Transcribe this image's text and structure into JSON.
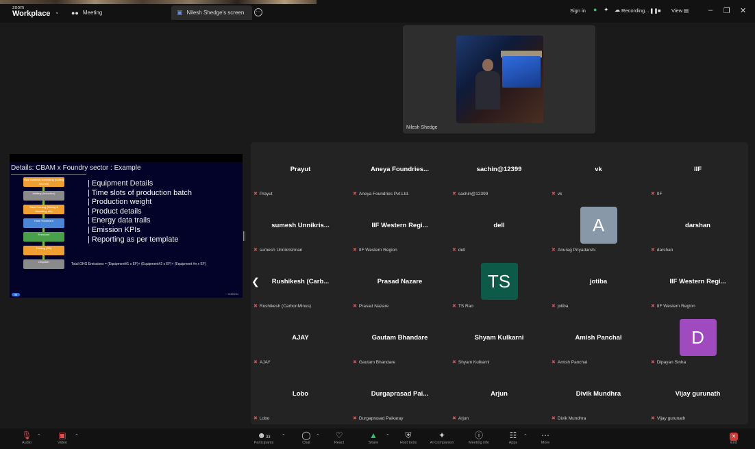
{
  "topbar": {
    "brand_small": "zoom",
    "brand_name": "Workplace",
    "tab_meeting": "Meeting",
    "tab_screen": "Nilesh Shedge's screen",
    "sign_in": "Sign in",
    "recording": "Recording...",
    "view": "View"
  },
  "video": {
    "name": "Nilesh Shedge"
  },
  "shared_slide": {
    "title": "Details: CBAM x Foundry sector : Example",
    "flow_steps": [
      {
        "label": "Raw material processing (cutting into bill)",
        "color": "#f0a030"
      },
      {
        "label": "Melting (Induction)",
        "color": "#8a8a8a"
      },
      {
        "label": "Sand Casting (Mixing & Moulding, etc)",
        "color": "#f0a030"
      },
      {
        "label": "Heat Treatment",
        "color": "#4a86d6"
      },
      {
        "label": "Knockout",
        "color": "#48a048"
      },
      {
        "label": "Fettling (SB)",
        "color": "#f0a030"
      },
      {
        "label": "Dispatch",
        "color": "#8a8a8a"
      }
    ],
    "bullets": [
      "Equipment Details",
      "Time slots of production batch",
      "Production weight",
      "Product details",
      "Energy data trails",
      "Emission KPIs",
      "Reporting as per template"
    ],
    "equation": "Total GHG Emissions = (Equipment#1 x EF)+ (Equipment#2 x EF)+ (Equipment #n x EF)",
    "page": "30",
    "logo": "CIZOON"
  },
  "participants": [
    {
      "display": "Prayut",
      "name": "Prayut"
    },
    {
      "display": "Aneya Foundries...",
      "name": "Aneya Foundries Pvt.Ltd."
    },
    {
      "display": "sachin@12399",
      "name": "sachin@12399"
    },
    {
      "display": "vk",
      "name": "vk"
    },
    {
      "display": "IIF",
      "name": "IIF"
    },
    {
      "display": "sumesh Unnikris...",
      "name": "sumesh Unnikrishnan"
    },
    {
      "display": "IIF Western Regi...",
      "name": "IIF Western Region"
    },
    {
      "display": "dell",
      "name": "dell"
    },
    {
      "display": "",
      "name": "Anurag Priyadarshi",
      "avatar": "A",
      "avatar_color": "#8898a8"
    },
    {
      "display": "darshan",
      "name": "darshan"
    },
    {
      "display": "Rushikesh (Carb...",
      "name": "Rushikesh (CarbonMinus)"
    },
    {
      "display": "Prasad Nazare",
      "name": "Prasad Nazare"
    },
    {
      "display": "",
      "name": "TS Rao",
      "avatar": "TS",
      "avatar_color": "#0e5a48"
    },
    {
      "display": "jotiba",
      "name": "jotiba"
    },
    {
      "display": "IIF Western Regi...",
      "name": "IIF Western Region"
    },
    {
      "display": "AJAY",
      "name": "AJAY"
    },
    {
      "display": "Gautam Bhandare",
      "name": "Gautam Bhandare"
    },
    {
      "display": "Shyam Kulkarni",
      "name": "Shyam Kulkarni"
    },
    {
      "display": "Amish Panchal",
      "name": "Amish Panchal"
    },
    {
      "display": "",
      "name": "Dipayan Sinha",
      "avatar": "D",
      "avatar_color": "#a04ac0"
    },
    {
      "display": "Lobo",
      "name": "Lobo"
    },
    {
      "display": "Durgaprasad Pai...",
      "name": "Durgaprasad Paikaray"
    },
    {
      "display": "Arjun",
      "name": "Arjun"
    },
    {
      "display": "Divik Mundhra",
      "name": "Divik Mundhra"
    },
    {
      "display": "Vijay gurunath",
      "name": "Vijay gurunath"
    }
  ],
  "toolbar": {
    "audio": "Audio",
    "video": "Video",
    "participants": "Participants",
    "participants_count": "33",
    "chat": "Chat",
    "react": "React",
    "share": "Share",
    "host_tools": "Host tools",
    "ai_companion": "AI Companion",
    "meeting_info": "Meeting info",
    "apps": "Apps",
    "more": "More",
    "end": "End"
  }
}
